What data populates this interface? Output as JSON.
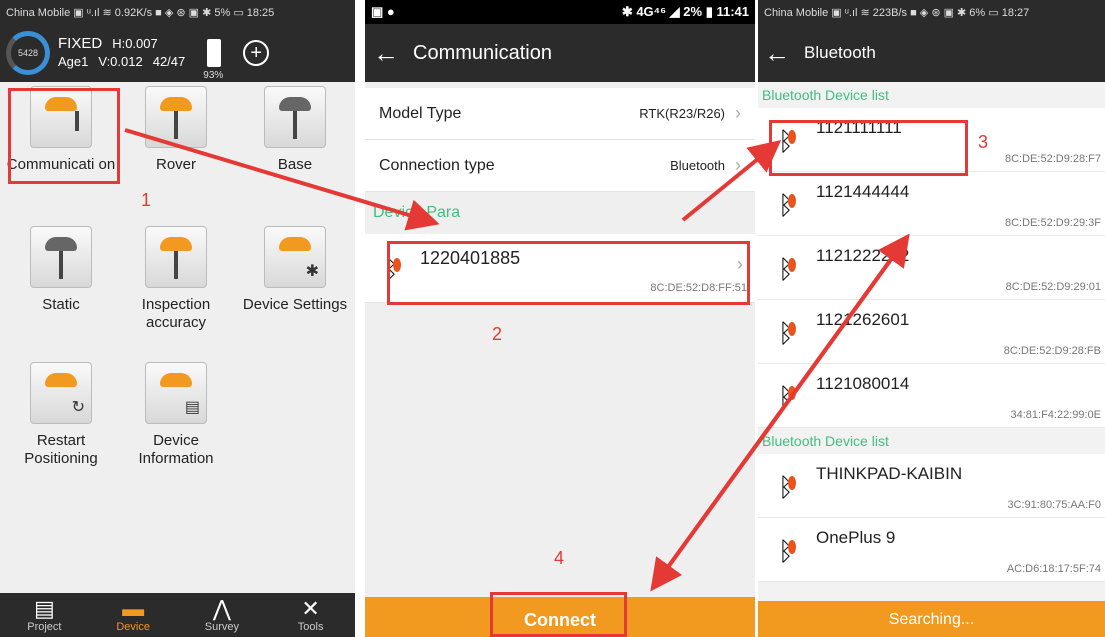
{
  "panel1": {
    "status": "China Mobile ▣ ᵘ.ıl ≋ 0.92K/s ■ ◈ ⊛ ▣ ✱ 5% ▭ 18:25",
    "ring_value": "5428",
    "solution": "FIXED",
    "h_precision": "H:0.007",
    "age": "Age1",
    "v_precision": "V:0.012",
    "satellites": "42/47",
    "battery": "93%",
    "tiles": [
      {
        "label": "Communicati on"
      },
      {
        "label": "Rover"
      },
      {
        "label": "Base"
      },
      {
        "label": "Static"
      },
      {
        "label": "Inspection accuracy"
      },
      {
        "label": "Device Settings"
      },
      {
        "label": "Restart Positioning"
      },
      {
        "label": "Device Information"
      }
    ],
    "tabs": [
      {
        "label": "Project",
        "icon": "list-icon"
      },
      {
        "label": "Device",
        "icon": "receiver-icon"
      },
      {
        "label": "Survey",
        "icon": "survey-icon"
      },
      {
        "label": "Tools",
        "icon": "tools-icon"
      }
    ]
  },
  "panel2": {
    "status_left": "▣ ●",
    "status_right": "✱ 4G⁴⁶ ◢ 2% ▮ 11:41",
    "title": "Communication",
    "model_type_label": "Model Type",
    "model_type_value": "RTK(R23/R26)",
    "connection_type_label": "Connection type",
    "connection_type_value": "Bluetooth",
    "section": "Device Para",
    "device_name": "1220401885",
    "device_mac": "8C:DE:52:D8:FF:51",
    "connect_label": "Connect"
  },
  "panel3": {
    "status": "China Mobile ▣ ᵘ.ıl ≋ 223B/s ■ ◈ ⊛ ▣ ✱ 6% ▭ 18:27",
    "title": "Bluetooth",
    "section1": "Bluetooth Device list",
    "section2": "Bluetooth Device list",
    "devices1": [
      {
        "name": "1121111111",
        "mac": "8C:DE:52:D9:28:F7"
      },
      {
        "name": "1121444444",
        "mac": "8C:DE:52:D9:29:3F"
      },
      {
        "name": "1121222222",
        "mac": "8C:DE:52:D9:29:01"
      },
      {
        "name": "1121262601",
        "mac": "8C:DE:52:D9:28:FB"
      },
      {
        "name": "1121080014",
        "mac": "34:81:F4:22:99:0E"
      }
    ],
    "devices2": [
      {
        "name": "THINKPAD-KAIBIN",
        "mac": "3C:91:80:75:AA:F0"
      },
      {
        "name": "OnePlus 9",
        "mac": "AC:D6:18:17:5F:74"
      }
    ],
    "searching_label": "Searching..."
  },
  "annotations": [
    "1",
    "2",
    "3",
    "4"
  ],
  "colors": {
    "accent": "#f29a1f",
    "annotation": "#e53935",
    "section": "#3fbf7f",
    "header": "#2b2b2b"
  }
}
